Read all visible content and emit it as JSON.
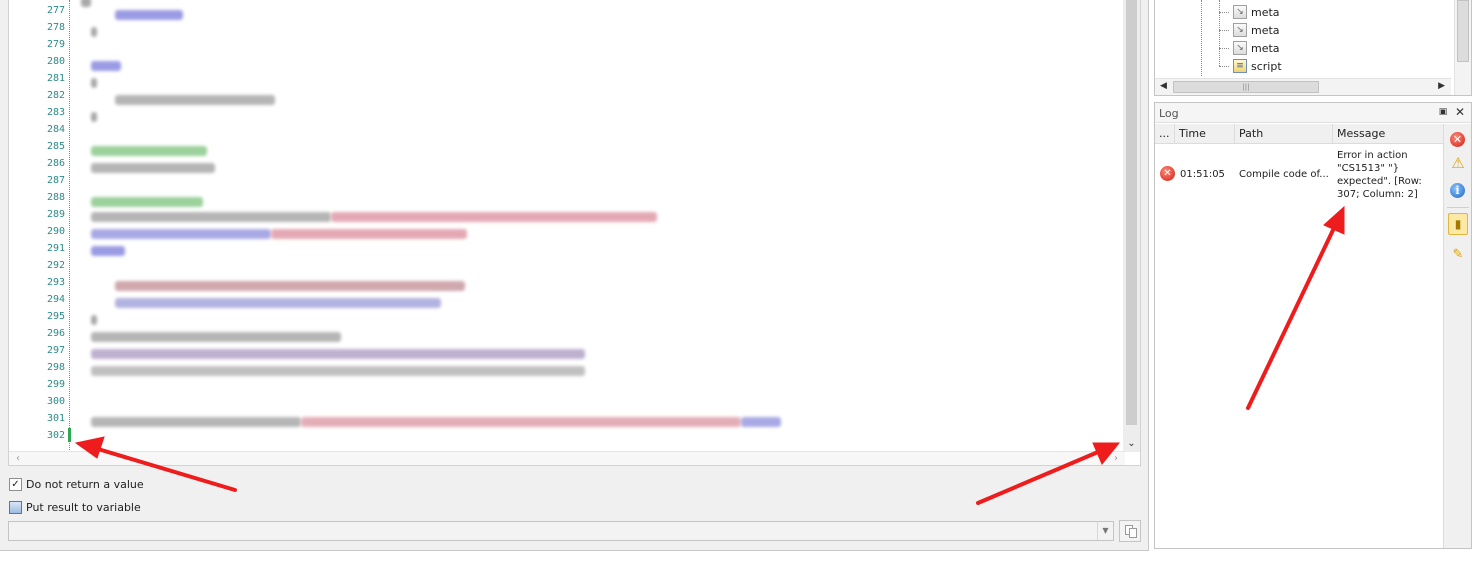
{
  "editor": {
    "line_numbers": [
      "277",
      "278",
      "279",
      "280",
      "281",
      "282",
      "283",
      "284",
      "285",
      "286",
      "287",
      "288",
      "289",
      "290",
      "291",
      "292",
      "293",
      "294",
      "295",
      "296",
      "297",
      "298",
      "299",
      "300",
      "301",
      "302"
    ]
  },
  "options": {
    "no_return_label": "Do not return a value",
    "no_return_checked": true,
    "put_result_label": "Put result to variable",
    "put_result_checked": false
  },
  "tree": {
    "items": [
      {
        "label": "meta",
        "icon": "meta-icon"
      },
      {
        "label": "meta",
        "icon": "meta-icon"
      },
      {
        "label": "meta",
        "icon": "meta-icon"
      },
      {
        "label": "script",
        "icon": "script-icon"
      }
    ]
  },
  "log": {
    "title": "Log",
    "columns": {
      "more": "...",
      "time": "Time",
      "path": "Path",
      "message": "Message"
    },
    "rows": [
      {
        "level": "error",
        "time": "01:51:05",
        "path": "Compile code of...",
        "message_lines": [
          "Error in action",
          "\"CS1513\" \"}",
          "expected\". [Row:",
          "307; Column: 2]"
        ]
      }
    ]
  },
  "colors": {
    "annotation_arrow": "#ee1c1c",
    "line_number": "#2b8a8a",
    "cursor_marker": "#2fa84f"
  }
}
